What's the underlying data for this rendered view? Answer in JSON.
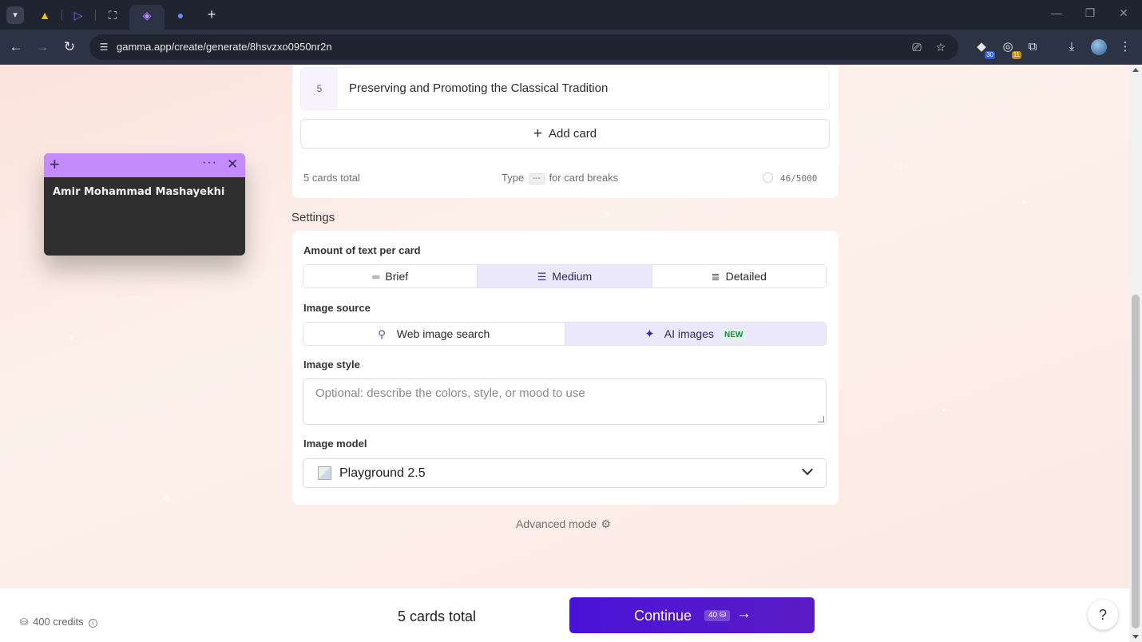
{
  "browser": {
    "url": "gamma.app/create/generate/8hsvzxo0950nr2n",
    "extensions": [
      {
        "icon": "extension-a-icon",
        "badge": "30",
        "badge_color": "#2d5be3"
      },
      {
        "icon": "extension-b-icon",
        "badge": "11",
        "badge_color": "#c78a10"
      }
    ]
  },
  "outline": {
    "card": {
      "number": "5",
      "title": "Preserving and Promoting the Classical Tradition"
    },
    "add_card_label": "Add card",
    "cards_total": "5 cards total",
    "type_prefix": "Type",
    "type_kbd": "---",
    "type_suffix": "for card breaks",
    "char_count": "46/5000"
  },
  "settings": {
    "heading": "Settings",
    "text_amount": {
      "label": "Amount of text per card",
      "options": [
        "Brief",
        "Medium",
        "Detailed"
      ],
      "selected": "Medium"
    },
    "image_source": {
      "label": "Image source",
      "options": [
        "Web image search",
        "AI images"
      ],
      "selected": "AI images",
      "badge": "NEW"
    },
    "image_style": {
      "label": "Image style",
      "placeholder": "Optional: describe the colors, style, or mood to use"
    },
    "image_model": {
      "label": "Image model",
      "value": "Playground 2.5"
    }
  },
  "advanced_mode_label": "Advanced mode",
  "note": {
    "text": "Amir Mohammad Mashayekhi",
    "accent": "#c48bff"
  },
  "footer": {
    "credits": "400 credits",
    "cards_total": "5 cards total",
    "continue_label": "Continue",
    "continue_cost": "40",
    "help_label": "?"
  },
  "colors": {
    "primary": "#4a12d8",
    "selected_bg": "#ece8fb",
    "new_badge": "#1e8a4b"
  }
}
